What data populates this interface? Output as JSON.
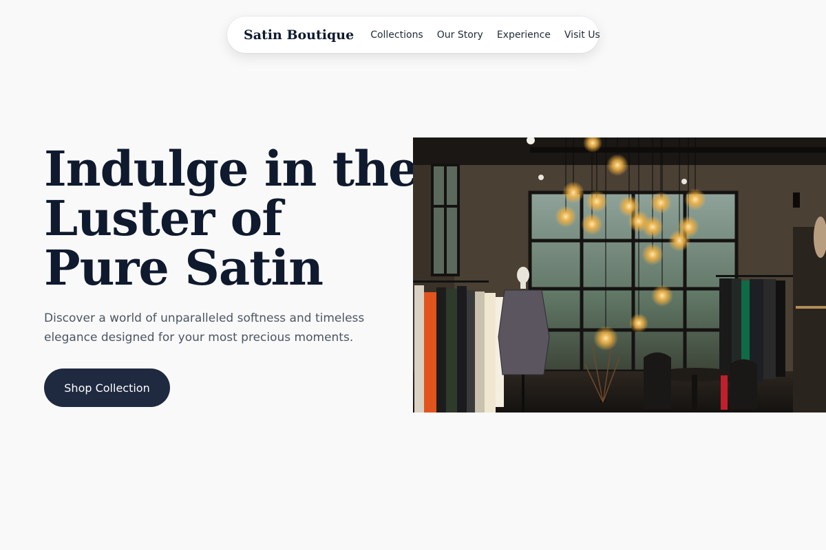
{
  "nav": {
    "brand": "Satin Boutique",
    "links": [
      "Collections",
      "Our Story",
      "Experience",
      "Visit Us"
    ]
  },
  "hero": {
    "title_lines": [
      "Indulge in the",
      "Luster of",
      "Pure Satin"
    ],
    "subtitle_line1": "Discover a world of unparalleled softness and timeless",
    "subtitle_line2": "elegance designed for your most precious moments.",
    "cta_label": "Shop Collection",
    "image_alt": "Boutique interior with clothing racks and hanging bulb lights"
  },
  "colors": {
    "background": "#f9f9f9",
    "text_dark": "#0f1a2e",
    "text_muted": "#4b5563",
    "cta_background": "#1f2a40",
    "nav_background": "#ffffff"
  }
}
